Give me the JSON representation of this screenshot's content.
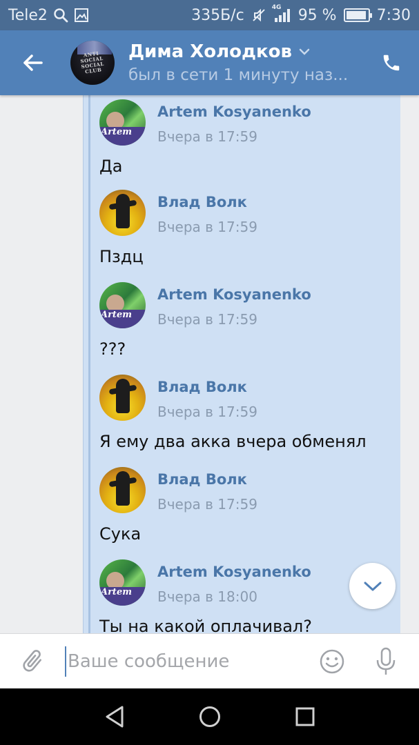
{
  "status_bar": {
    "carrier": "Tele2",
    "speed": "335Б/с",
    "network": "4G",
    "battery": "95 %",
    "battery_level": 0.95,
    "time": "7:30",
    "icons": [
      "search-icon",
      "image-icon",
      "mute-icon",
      "signal-icon",
      "battery-icon"
    ]
  },
  "header": {
    "title": "Дима Холодков",
    "subtitle": "был в сети 1 минуту наз...",
    "avatar_text": "ANTI SOCIAL SOCIAL CLUB",
    "icons": [
      "back-arrow-icon",
      "chevron-down-icon",
      "phone-icon"
    ]
  },
  "messages": [
    {
      "author": "Artem Kosyanenko",
      "time": "Вчера в 17:59",
      "text": "Да",
      "avatar": "artem",
      "avatar_tag": "Artem"
    },
    {
      "author": "Влад Волк",
      "time": "Вчера в 17:59",
      "text": "Пздц",
      "avatar": "vlad"
    },
    {
      "author": "Artem Kosyanenko",
      "time": "Вчера в 17:59",
      "text": "???",
      "avatar": "artem",
      "avatar_tag": "Artem"
    },
    {
      "author": "Влад Волк",
      "time": "Вчера в 17:59",
      "text": "Я ему два акка вчера обменял",
      "avatar": "vlad"
    },
    {
      "author": "Влад Волк",
      "time": "Вчера в 17:59",
      "text": "Сука",
      "avatar": "vlad"
    },
    {
      "author": "Artem Kosyanenko",
      "time": "Вчера в 18:00",
      "text": "Ты на какой оплачивал?",
      "avatar": "artem",
      "avatar_tag": "Artem"
    }
  ],
  "composer": {
    "placeholder": "Ваше сообщение",
    "value": "",
    "icons": [
      "paperclip-icon",
      "smile-icon",
      "microphone-icon"
    ]
  },
  "colors": {
    "header": "#5181b8",
    "status_bar": "#4a6c93",
    "bubble": "#cfe0f4",
    "author_name": "#4a76a8"
  }
}
